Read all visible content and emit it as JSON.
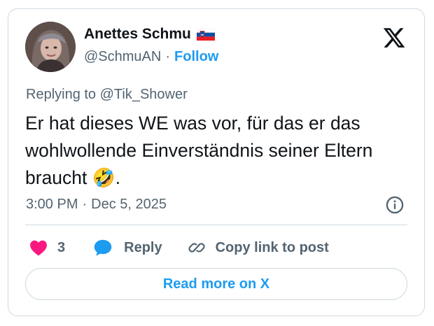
{
  "author": {
    "display_name": "Anettes Schmu",
    "flag_icon": "slovenia-flag-icon",
    "handle": "@SchmuAN",
    "separator": "·",
    "follow_label": "Follow"
  },
  "reply_context": "Replying to @Tik_Shower",
  "tweet": {
    "text": "Er hat dieses WE was vor, für das er das wohlwollende Einverständnis seiner Eltern braucht 🤣.",
    "time": "3:00 PM",
    "separator": "·",
    "date": "Dec 5, 2025"
  },
  "actions": {
    "like_count": "3",
    "reply_label": "Reply",
    "copy_link_label": "Copy link to post"
  },
  "read_more_label": "Read more on X",
  "icons": {
    "platform": "x-logo-icon",
    "info": "info-icon",
    "like": "heart-icon",
    "reply": "speech-bubble-icon",
    "copy": "link-icon"
  },
  "colors": {
    "accent": "#1d9bf0",
    "like": "#f91880",
    "text": "#0f1419",
    "secondary": "#536471",
    "border": "#cfd9de"
  }
}
